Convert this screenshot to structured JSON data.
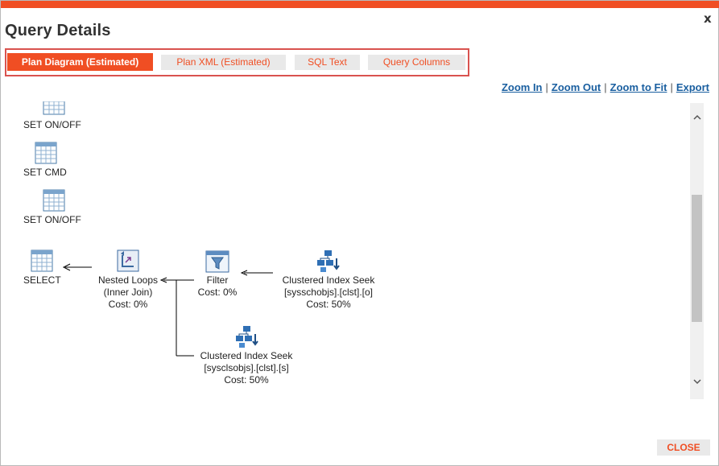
{
  "window": {
    "title": "Query Details",
    "close_glyph": "x"
  },
  "tabs": [
    {
      "label": "Plan Diagram (Estimated)",
      "active": true
    },
    {
      "label": "Plan XML (Estimated)",
      "active": false
    },
    {
      "label": "SQL Text",
      "active": false
    },
    {
      "label": "Query Columns",
      "active": false
    }
  ],
  "toolbar": {
    "zoom_in": "Zoom In",
    "zoom_out": "Zoom Out",
    "zoom_fit": "Zoom to Fit",
    "export": "Export",
    "separator": "|"
  },
  "plan": {
    "set_on_off_1": "SET ON/OFF",
    "set_cmd": "SET CMD",
    "set_on_off_2": "SET ON/OFF",
    "select": "SELECT",
    "nested_loops": {
      "name": "Nested Loops",
      "detail": "(Inner Join)",
      "cost": "Cost: 0%"
    },
    "filter": {
      "name": "Filter",
      "cost": "Cost: 0%"
    },
    "seek_o": {
      "name": "Clustered Index Seek",
      "detail": "[sysschobjs].[clst].[o]",
      "cost": "Cost: 50%"
    },
    "seek_s": {
      "name": "Clustered Index Seek",
      "detail": "[sysclsobjs].[clst].[s]",
      "cost": "Cost: 50%"
    }
  },
  "footer": {
    "close_label": "CLOSE"
  },
  "colors": {
    "accent": "#f04e23",
    "link": "#1a5fa0"
  },
  "scrollbar": {
    "position": 0.55
  }
}
